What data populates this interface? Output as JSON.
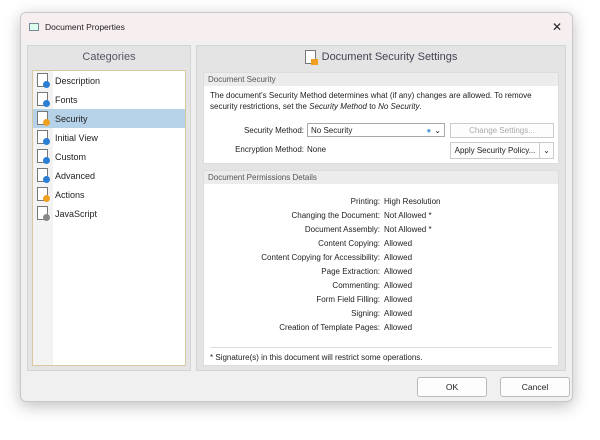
{
  "window": {
    "title": "Document Properties",
    "close": "✕"
  },
  "categories": {
    "title": "Categories",
    "items": [
      {
        "label": "Description",
        "badge": "#2a7fd4"
      },
      {
        "label": "Fonts",
        "badge": "#2a7fd4"
      },
      {
        "label": "Security",
        "badge": "#f0a020",
        "selected": true
      },
      {
        "label": "Initial View",
        "badge": "#2a7fd4"
      },
      {
        "label": "Custom",
        "badge": "#2a7fd4"
      },
      {
        "label": "Advanced",
        "badge": "#2a7fd4"
      },
      {
        "label": "Actions",
        "badge": "#f0a020"
      },
      {
        "label": "JavaScript",
        "badge": "#888"
      }
    ]
  },
  "main": {
    "title": "Document Security Settings",
    "security": {
      "title": "Document Security",
      "desc_1": "The document's Security Method determines what (if any) changes are allowed. To remove security restrictions, set the ",
      "desc_em1": "Security Method",
      "desc_2": " to ",
      "desc_em2": "No Security",
      "desc_3": ".",
      "method_label": "Security Method:",
      "method_value": "No Security",
      "change_settings": "Change Settings...",
      "encryption_label": "Encryption Method:",
      "encryption_value": "None",
      "apply_policy": "Apply Security Policy..."
    },
    "permissions": {
      "title": "Document Permissions Details",
      "rows": [
        {
          "k": "Printing:",
          "v": "High Resolution"
        },
        {
          "k": "Changing the Document:",
          "v": "Not Allowed *"
        },
        {
          "k": "Document Assembly:",
          "v": "Not Allowed *"
        },
        {
          "k": "Content Copying:",
          "v": "Allowed"
        },
        {
          "k": "Content Copying for Accessibility:",
          "v": "Allowed"
        },
        {
          "k": "Page Extraction:",
          "v": "Allowed"
        },
        {
          "k": "Commenting:",
          "v": "Allowed"
        },
        {
          "k": "Form Field Filling:",
          "v": "Allowed"
        },
        {
          "k": "Signing:",
          "v": "Allowed"
        },
        {
          "k": "Creation of Template Pages:",
          "v": "Allowed"
        }
      ],
      "note": "* Signature(s) in this document will restrict some operations."
    }
  },
  "footer": {
    "ok": "OK",
    "cancel": "Cancel"
  }
}
